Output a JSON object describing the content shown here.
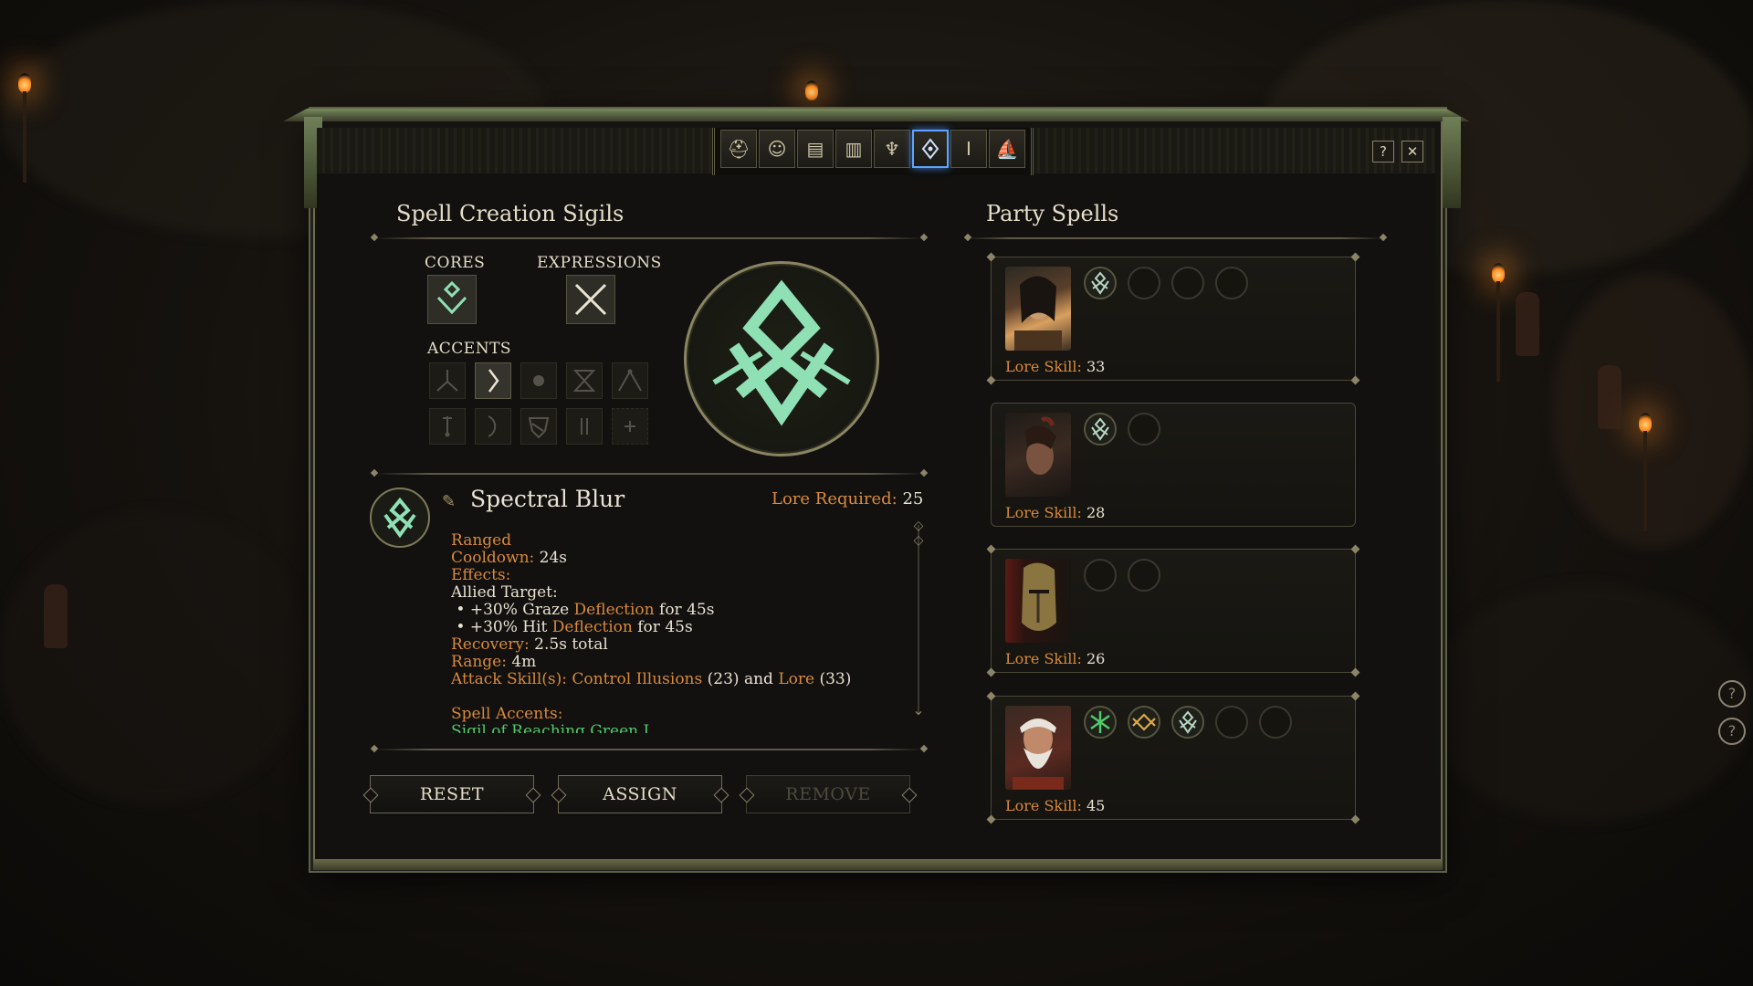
{
  "tabs": [
    {
      "icon": "helmet-icon"
    },
    {
      "icon": "bust-icon"
    },
    {
      "icon": "hierarchy-icon"
    },
    {
      "icon": "journal-icon"
    },
    {
      "icon": "chalice-icon"
    },
    {
      "icon": "sigil-grimoire-icon",
      "active": true
    },
    {
      "icon": "pillar-icon"
    },
    {
      "icon": "ship-icon"
    }
  ],
  "window": {
    "help_label": "?",
    "close_label": "✕"
  },
  "left": {
    "title": "Spell Creation Sigils",
    "cores_label": "CORES",
    "expressions_label": "EXPRESSIONS",
    "accents_label": "ACCENTS"
  },
  "spell": {
    "name": "Spectral Blur",
    "lore_required_label": "Lore Required:",
    "lore_required_value": "25",
    "lines": {
      "type": "Ranged",
      "cooldown_label": "Cooldown:",
      "cooldown_value": "24s",
      "effects_label": "Effects:",
      "target": "Allied Target:",
      "bullet1_pre": "• +30% Graze ",
      "bullet1_kw": "Deflection",
      "bullet1_post": " for 45s",
      "bullet2_pre": "• +30% Hit ",
      "bullet2_kw": "Deflection",
      "bullet2_post": " for 45s",
      "recovery_label": "Recovery:",
      "recovery_value": "2.5s total",
      "range_label": "Range:",
      "range_value": "4m",
      "attack_label": "Attack Skill(s):",
      "attack_skill1": "Control Illusions",
      "attack_skill1_val": "(23)",
      "attack_and": "and",
      "attack_skill2": "Lore",
      "attack_skill2_val": "(33)",
      "accents_label": "Spell Accents:",
      "accent_line": "Sigil of Reaching Green I"
    }
  },
  "buttons": {
    "reset": "RESET",
    "assign": "ASSIGN",
    "remove": "REMOVE"
  },
  "party": {
    "title": "Party Spells",
    "lore_label": "Lore Skill:",
    "members": [
      {
        "lore": "33",
        "slots": 4
      },
      {
        "lore": "28",
        "slots": 2
      },
      {
        "lore": "26",
        "slots": 2
      },
      {
        "lore": "45",
        "slots": 5
      }
    ]
  },
  "colors": {
    "accent_green": "#8fe0b4",
    "lore_orange": "#d98a3a",
    "active_tab": "#5ea4ff"
  }
}
